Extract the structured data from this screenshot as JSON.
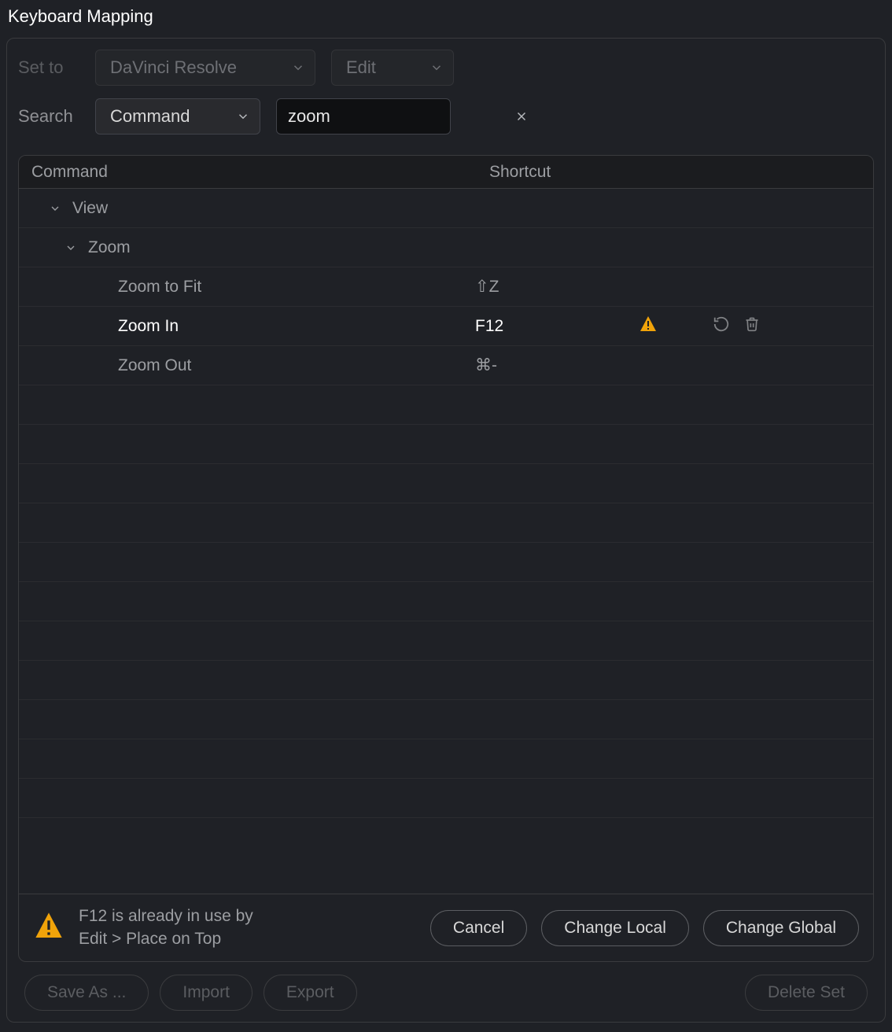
{
  "title": "Keyboard Mapping",
  "controls": {
    "set_to_label": "Set to",
    "preset": "DaVinci Resolve",
    "context": "Edit",
    "search_label": "Search",
    "search_mode": "Command",
    "search_value": "zoom"
  },
  "table": {
    "headers": {
      "command": "Command",
      "shortcut": "Shortcut"
    }
  },
  "tree": {
    "group0": {
      "label": "View"
    },
    "group1": {
      "label": "Zoom"
    },
    "item0": {
      "label": "Zoom to Fit",
      "shortcut": "⇧Z"
    },
    "item1": {
      "label": "Zoom In",
      "shortcut": "F12"
    },
    "item2": {
      "label": "Zoom Out",
      "shortcut": "⌘-"
    }
  },
  "conflict": {
    "line1": "F12 is already in use by",
    "line2": "Edit > Place on Top",
    "cancel": "Cancel",
    "local": "Change Local",
    "global": "Change Global"
  },
  "footer": {
    "save_as": "Save As ...",
    "import": "Import",
    "export": "Export",
    "delete_set": "Delete Set"
  }
}
